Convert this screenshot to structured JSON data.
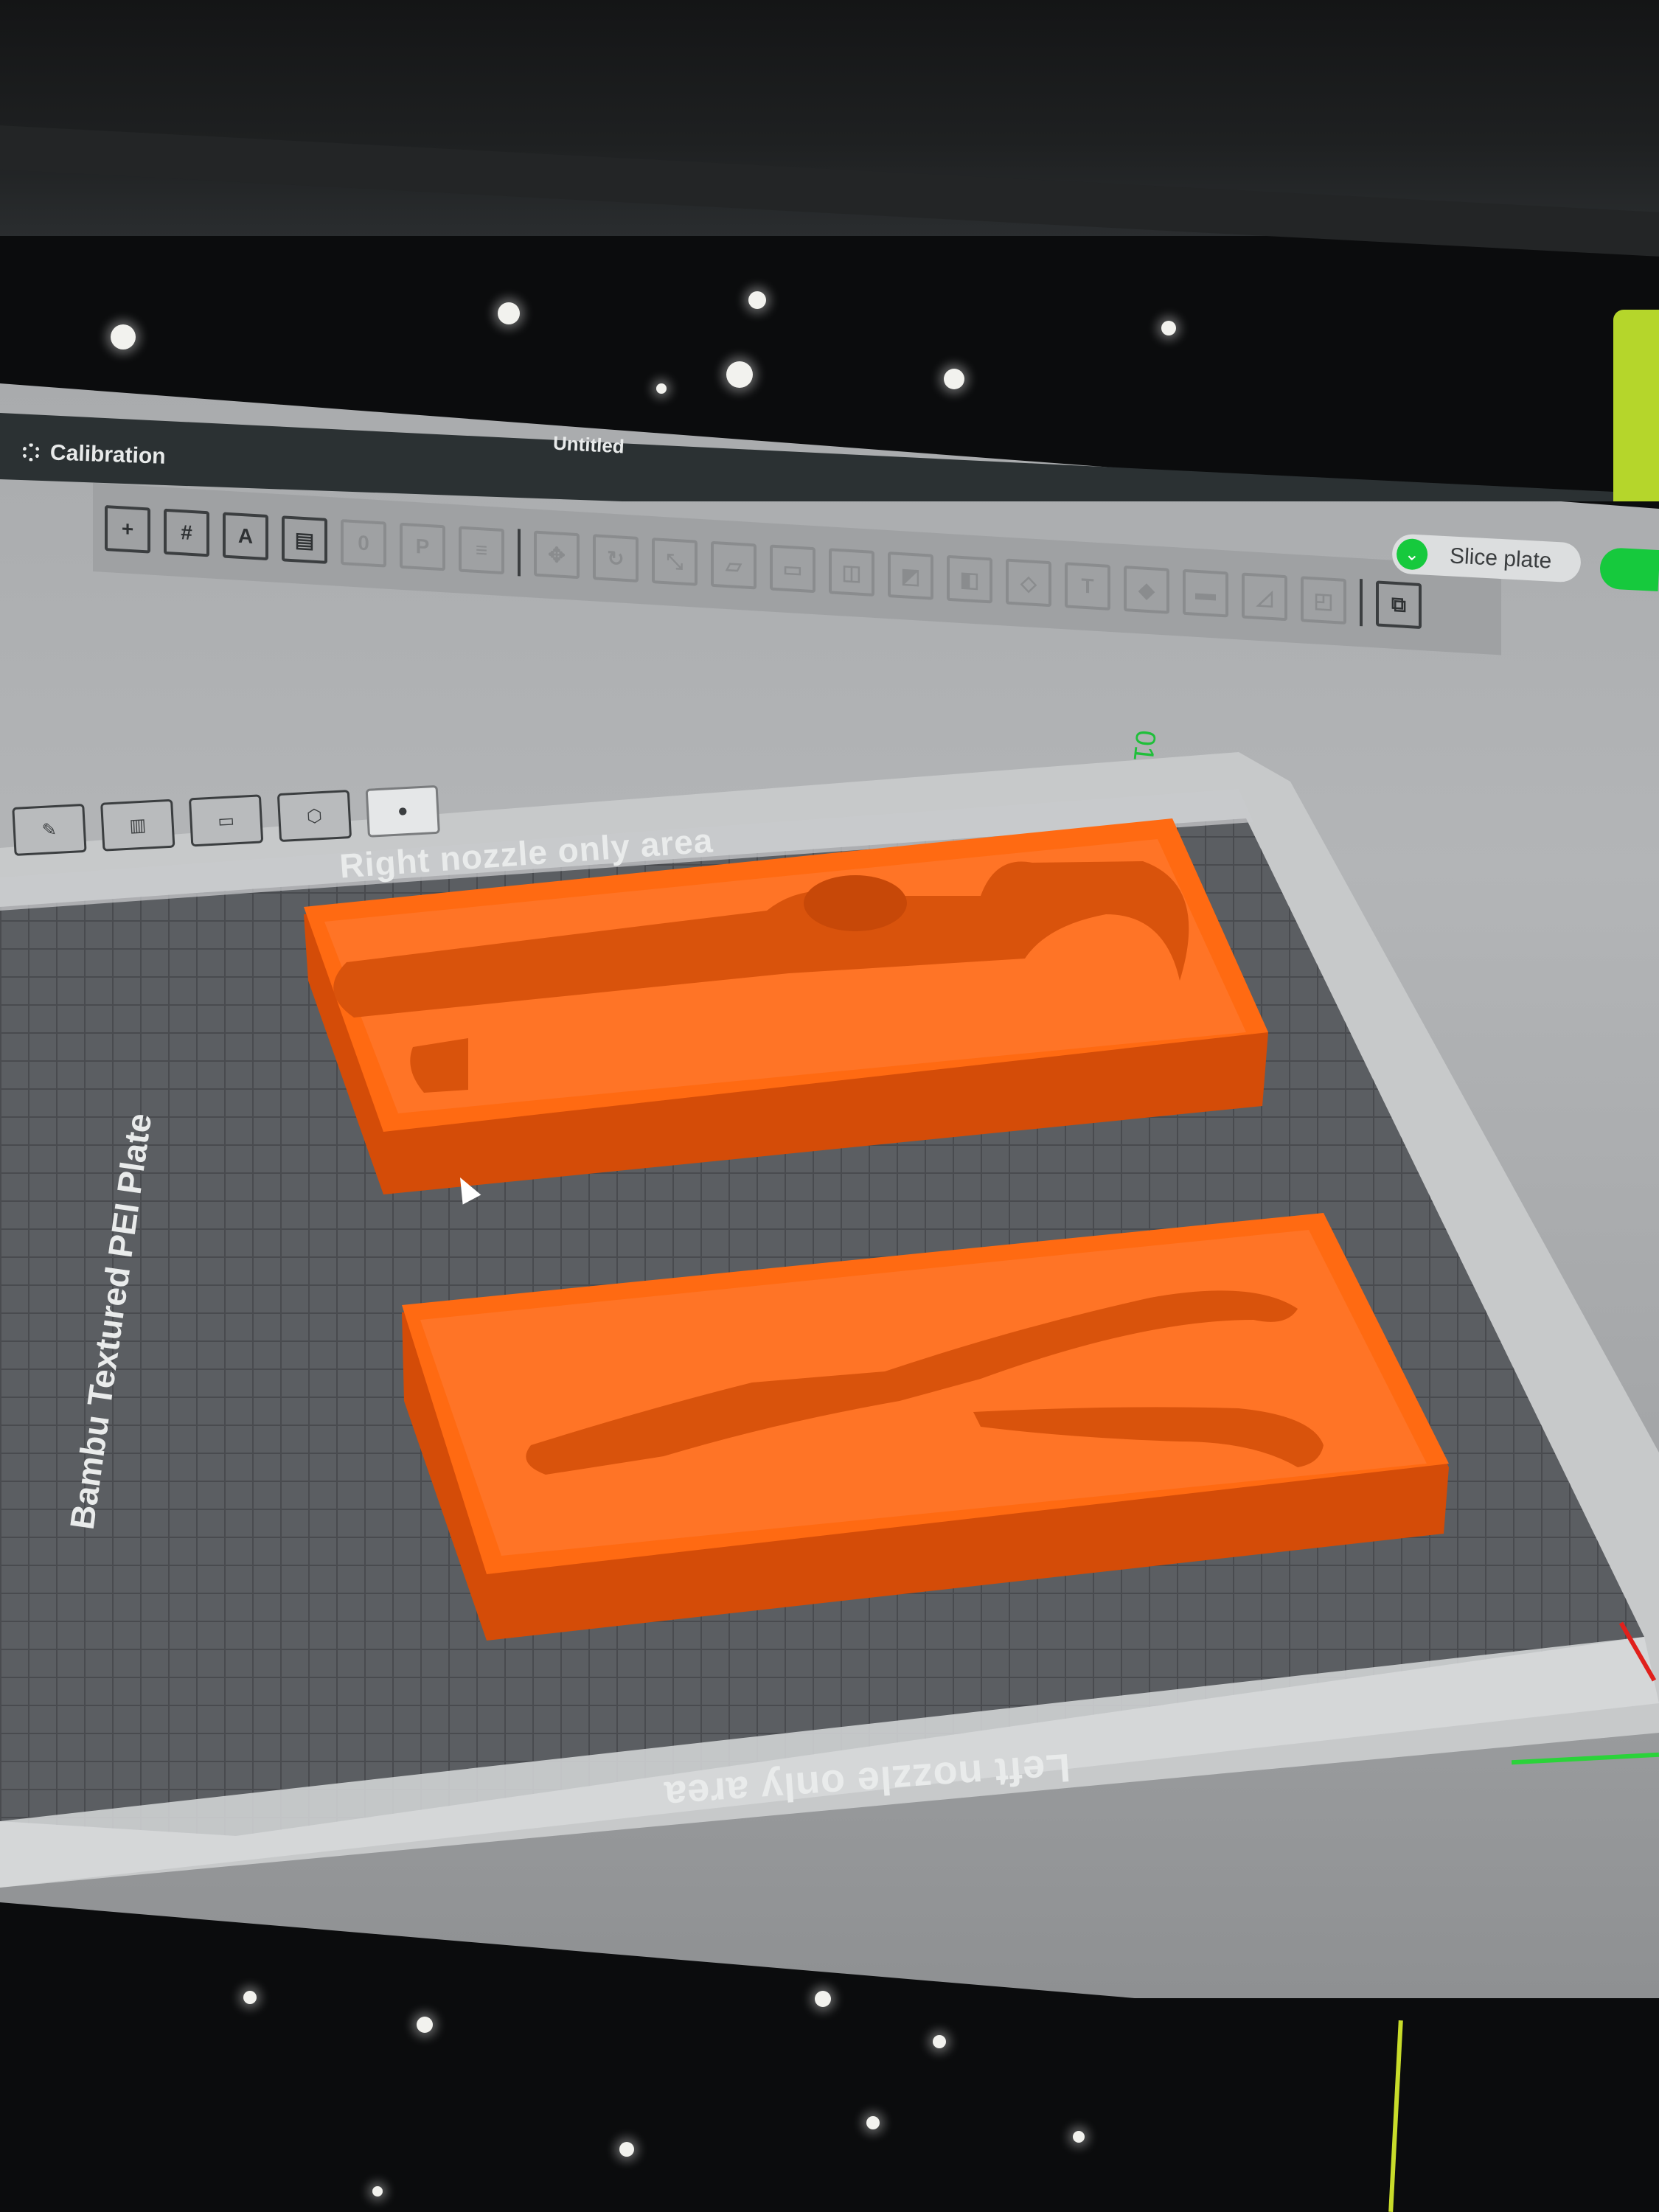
{
  "app": {
    "menu_title": "Calibration",
    "document_title": "Untitled"
  },
  "toolbar": {
    "icons": [
      "add-object-icon",
      "add-plate-icon",
      "auto-arrange-icon",
      "layout-icon",
      "orient-icon",
      "plate-icon",
      "layers-icon",
      "move-icon",
      "rotate-icon",
      "scale-icon",
      "lay-flat-icon",
      "cut-icon",
      "mesh-boolean-icon",
      "support-painting-icon",
      "seam-painting-icon",
      "measure-icon",
      "text-icon",
      "color-painting-icon",
      "variable-layer-icon",
      "assembly-icon",
      "arrange-icon",
      "split-icon"
    ],
    "slice_label": "Slice plate"
  },
  "viewport": {
    "right_nozzle_label": "Right nozzle only area",
    "left_nozzle_label": "Left nozzle only area",
    "plate_type_label": "Bambu Textured PEI Plate",
    "plate_number": "01"
  },
  "colors": {
    "filament": "#ff6a12",
    "slice_accent": "#16c93d",
    "titlebar": "#2b3133"
  }
}
